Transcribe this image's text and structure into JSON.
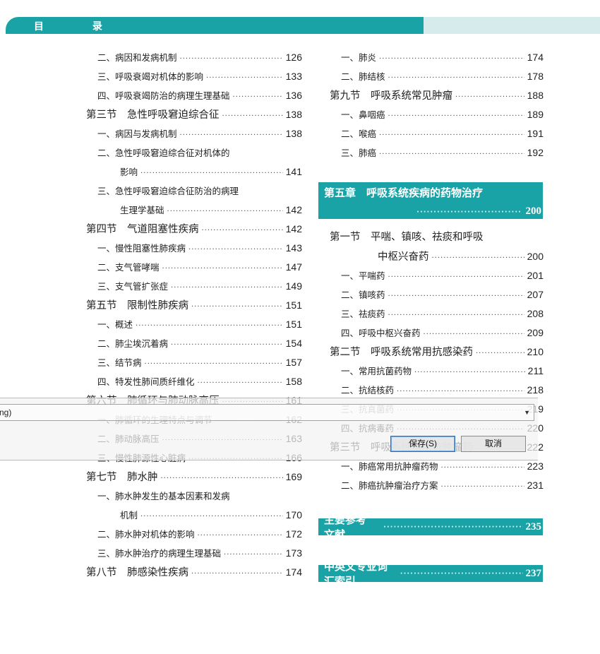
{
  "header": {
    "title": "目 录"
  },
  "left": [
    {
      "kind": "sub",
      "title": "二、病因和发病机制",
      "page": "126"
    },
    {
      "kind": "sub",
      "title": "三、呼吸衰竭对机体的影响",
      "page": "133"
    },
    {
      "kind": "sub",
      "title": "四、呼吸衰竭防治的病理生理基础",
      "page": "136"
    },
    {
      "kind": "sec",
      "title": "第三节　急性呼吸窘迫综合征",
      "page": "138"
    },
    {
      "kind": "sub",
      "title": "一、病因与发病机制",
      "page": "138"
    },
    {
      "kind": "subh",
      "title": "二、急性呼吸窘迫综合征对机体的",
      "page": ""
    },
    {
      "kind": "cont",
      "title": "影响",
      "page": "141"
    },
    {
      "kind": "subh",
      "title": "三、急性呼吸窘迫综合征防治的病理",
      "page": ""
    },
    {
      "kind": "cont",
      "title": "生理学基础",
      "page": "142"
    },
    {
      "kind": "sec",
      "title": "第四节　气道阻塞性疾病",
      "page": "142"
    },
    {
      "kind": "sub",
      "title": "一、慢性阻塞性肺疾病",
      "page": "143"
    },
    {
      "kind": "sub",
      "title": "二、支气管哮喘",
      "page": "147"
    },
    {
      "kind": "sub",
      "title": "三、支气管扩张症",
      "page": "149"
    },
    {
      "kind": "sec",
      "title": "第五节　限制性肺疾病",
      "page": "151"
    },
    {
      "kind": "sub",
      "title": "一、概述",
      "page": "151"
    },
    {
      "kind": "sub",
      "title": "二、肺尘埃沉着病",
      "page": "154"
    },
    {
      "kind": "sub",
      "title": "三、结节病",
      "page": "157"
    },
    {
      "kind": "sub",
      "title": "四、特发性肺间质纤维化",
      "page": "158"
    },
    {
      "kind": "sec",
      "title": "第六节　肺循环与肺动脉高压",
      "page": "161"
    },
    {
      "kind": "sub",
      "title": "一、肺循环的生理特点与调节",
      "page": "162"
    },
    {
      "kind": "sub",
      "title": "二、肺动脉高压",
      "page": "163"
    },
    {
      "kind": "sub",
      "title": "三、慢性肺源性心脏病",
      "page": "166"
    },
    {
      "kind": "sec",
      "title": "第七节　肺水肿",
      "page": "169"
    },
    {
      "kind": "subh",
      "title": "一、肺水肿发生的基本因素和发病",
      "page": ""
    },
    {
      "kind": "cont",
      "title": "机制",
      "page": "170"
    },
    {
      "kind": "sub",
      "title": "二、肺水肿对机体的影响",
      "page": "172"
    },
    {
      "kind": "sub",
      "title": "三、肺水肿治疗的病理生理基础",
      "page": "173"
    },
    {
      "kind": "sec",
      "title": "第八节　肺感染性疾病",
      "page": "174"
    }
  ],
  "right_top": [
    {
      "kind": "sub",
      "title": "一、肺炎",
      "page": "174"
    },
    {
      "kind": "sub",
      "title": "二、肺结核",
      "page": "178"
    },
    {
      "kind": "sec",
      "title": "第九节　呼吸系统常见肿瘤",
      "page": "188"
    },
    {
      "kind": "sub",
      "title": "一、鼻咽癌",
      "page": "189"
    },
    {
      "kind": "sub",
      "title": "二、喉癌",
      "page": "191"
    },
    {
      "kind": "sub",
      "title": "三、肺癌",
      "page": "192"
    }
  ],
  "chapter5": {
    "title": "第五章　呼吸系统疾病的药物治疗",
    "page": "200"
  },
  "right_mid": [
    {
      "kind": "sech",
      "title": "第一节　平喘、镇咳、祛痰和呼吸",
      "page": ""
    },
    {
      "kind": "secc",
      "title": "中枢兴奋药",
      "page": "200"
    },
    {
      "kind": "sub",
      "title": "一、平喘药",
      "page": "201"
    },
    {
      "kind": "sub",
      "title": "二、镇咳药",
      "page": "207"
    },
    {
      "kind": "sub",
      "title": "三、祛痰药",
      "page": "208"
    },
    {
      "kind": "sub",
      "title": "四、呼吸中枢兴奋药",
      "page": "209"
    },
    {
      "kind": "sec",
      "title": "第二节　呼吸系统常用抗感染药",
      "page": "210"
    },
    {
      "kind": "sub",
      "title": "一、常用抗菌药物",
      "page": "211"
    },
    {
      "kind": "sub",
      "title": "二、抗结核药",
      "page": "218"
    },
    {
      "kind": "sub",
      "title": "三、抗真菌药",
      "page": "219"
    },
    {
      "kind": "sub",
      "title": "四、抗病毒药",
      "page": "220"
    },
    {
      "kind": "sec",
      "title": "第三节　呼吸系统常用抗肿瘤药",
      "page": "222"
    },
    {
      "kind": "sub",
      "title": "一、肺癌常用抗肿瘤药物",
      "page": "223"
    },
    {
      "kind": "sub",
      "title": "二、肺癌抗肿瘤治疗方案",
      "page": "231"
    }
  ],
  "references": {
    "title": "主要参考文献",
    "page": "235"
  },
  "index": {
    "title": "中英文专业词汇索引",
    "page": "237"
  },
  "dialog": {
    "field_text": "ng)",
    "save_label": "保存(S)",
    "cancel_label": "取消"
  }
}
